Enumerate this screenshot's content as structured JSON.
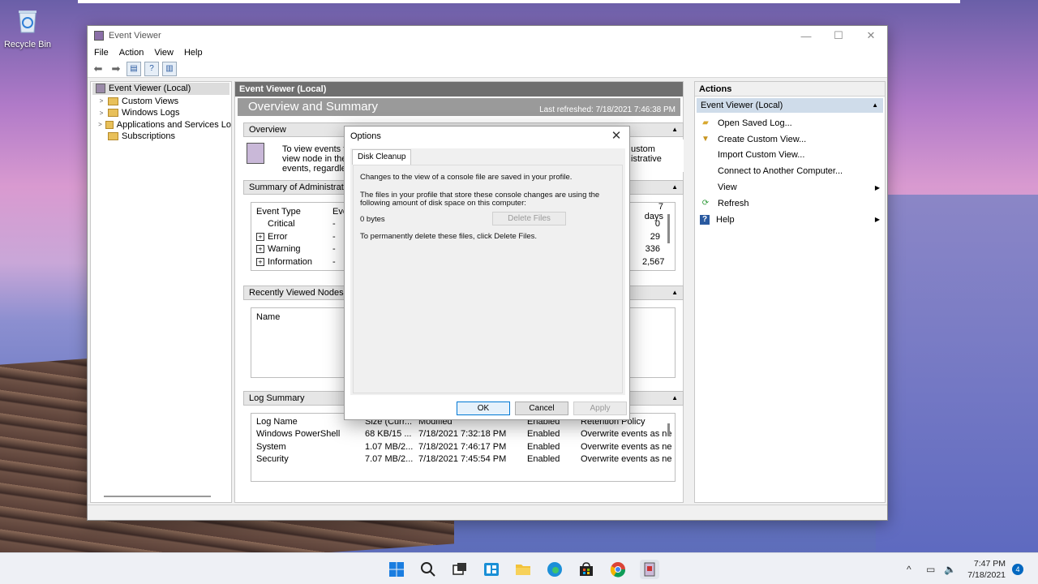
{
  "desktop": {
    "recycle_bin_label": "Recycle Bin"
  },
  "window": {
    "title": "Event Viewer",
    "menu": [
      "File",
      "Action",
      "View",
      "Help"
    ],
    "controls": {
      "minimize": "—",
      "maximize": "☐",
      "close": "✕"
    }
  },
  "tree": {
    "items": [
      {
        "label": "Event Viewer (Local)",
        "selected": true
      },
      {
        "label": "Custom Views"
      },
      {
        "label": "Windows Logs"
      },
      {
        "label": "Applications and Services Lo"
      },
      {
        "label": "Subscriptions"
      }
    ]
  },
  "center": {
    "header": "Event Viewer (Local)",
    "banner_title": "Overview and Summary",
    "last_refreshed": "Last refreshed: 7/18/2021 7:46:38 PM",
    "overview": {
      "title": "Overview",
      "text_line1": "To view events th",
      "text_line2": "view node in the",
      "text_line3": "events, regardles",
      "text_right1": "ustom",
      "text_right2": "istrative"
    },
    "admin_summary": {
      "title": "Summary of Administrati",
      "col_event_type": "Event Type",
      "col_eve": "Eve",
      "col_7days": "7 days",
      "rows": [
        {
          "type": "Critical",
          "dash": "-",
          "days": "0",
          "expand": false
        },
        {
          "type": "Error",
          "dash": "-",
          "days": "29",
          "expand": true
        },
        {
          "type": "Warning",
          "dash": "-",
          "days": "336",
          "expand": true
        },
        {
          "type": "Information",
          "dash": "-",
          "days": "2,567",
          "expand": true
        }
      ]
    },
    "recent": {
      "title": "Recently Viewed Nodes",
      "col_name": "Name"
    },
    "log_summary": {
      "title": "Log Summary",
      "headers": [
        "Log Name",
        "Size (Curr...",
        "Modified",
        "Enabled",
        "Retention Policy"
      ],
      "rows": [
        [
          "Windows PowerShell",
          "68 KB/15 ...",
          "7/18/2021 7:32:18 PM",
          "Enabled",
          "Overwrite events as ne"
        ],
        [
          "System",
          "1.07 MB/2...",
          "7/18/2021 7:46:17 PM",
          "Enabled",
          "Overwrite events as ne"
        ],
        [
          "Security",
          "7.07 MB/2...",
          "7/18/2021 7:45:54 PM",
          "Enabled",
          "Overwrite events as ne"
        ]
      ]
    }
  },
  "actions": {
    "header": "Actions",
    "section": "Event Viewer (Local)",
    "items": [
      {
        "label": "Open Saved Log...",
        "icon": "folder-open-icon",
        "submenu": false
      },
      {
        "label": "Create Custom View...",
        "icon": "filter-icon",
        "submenu": false
      },
      {
        "label": "Import Custom View...",
        "icon": "",
        "submenu": false
      },
      {
        "label": "Connect to Another Computer...",
        "icon": "",
        "submenu": false
      },
      {
        "label": "View",
        "icon": "",
        "submenu": true
      },
      {
        "label": "Refresh",
        "icon": "refresh-icon",
        "submenu": false
      },
      {
        "label": "Help",
        "icon": "help-icon",
        "submenu": true
      }
    ]
  },
  "dialog": {
    "title": "Options",
    "tab": "Disk Cleanup",
    "line1": "Changes to the view of a console file are saved in your profile.",
    "line2a": "The files in your profile that store these console changes are using the",
    "line2b": "following amount of disk space on this computer:",
    "size": "0 bytes",
    "delete_button": "Delete Files",
    "line3": "To permanently delete these files, click Delete Files.",
    "ok": "OK",
    "cancel": "Cancel",
    "apply": "Apply"
  },
  "taskbar": {
    "time": "7:47 PM",
    "date": "7/18/2021",
    "notification_count": "4",
    "colors": {
      "accent": "#0067c0"
    }
  }
}
